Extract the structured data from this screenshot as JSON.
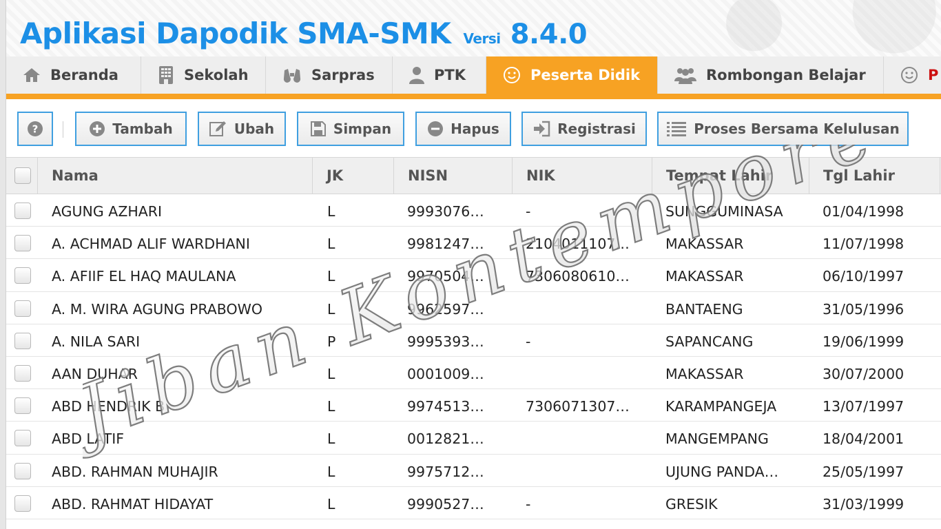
{
  "app": {
    "title": "Aplikasi Dapodik SMA-SMK",
    "version_label": "Versi",
    "version": "8.4.0"
  },
  "tabs": [
    {
      "label": "Beranda",
      "icon": "home-icon"
    },
    {
      "label": "Sekolah",
      "icon": "building-icon"
    },
    {
      "label": "Sarpras",
      "icon": "binoculars-icon"
    },
    {
      "label": "PTK",
      "icon": "user-icon"
    },
    {
      "label": "Peserta Didik",
      "icon": "smile-icon",
      "active": true
    },
    {
      "label": "Rombongan Belajar",
      "icon": "group-icon"
    },
    {
      "label": "P",
      "icon": "smile-icon"
    }
  ],
  "toolbar": {
    "tambah": "Tambah",
    "ubah": "Ubah",
    "simpan": "Simpan",
    "hapus": "Hapus",
    "registrasi": "Registrasi",
    "kelulusan": "Proses Bersama Kelulusan"
  },
  "table": {
    "headers": [
      "Nama",
      "JK",
      "NISN",
      "NIK",
      "Tempat Lahir",
      "Tgl Lahir"
    ],
    "rows": [
      [
        "AGUNG AZHARI",
        "L",
        "9993076…",
        "-",
        "SUNGGUMINASA",
        "01/04/1998"
      ],
      [
        "A. ACHMAD ALIF WARDHANI",
        "L",
        "9981247…",
        "2104011107…",
        "MAKASSAR",
        "11/07/1998"
      ],
      [
        "A. AFIIF EL HAQ MAULANA",
        "L",
        "9970504…",
        "7306080610…",
        "MAKASSAR",
        "06/10/1997"
      ],
      [
        "A. M. WIRA AGUNG PRABOWO",
        "L",
        "9962597…",
        "",
        "BANTAENG",
        "31/05/1996"
      ],
      [
        "A. NILA SARI",
        "P",
        "9995393…",
        "-",
        "SAPANCANG",
        "19/06/1999"
      ],
      [
        "AAN DUHAR",
        "L",
        "0001009…",
        "",
        "MAKASSAR",
        "30/07/2000"
      ],
      [
        "ABD HENDRIK B",
        "L",
        "9974513…",
        "7306071307…",
        "KARAMPANGEJA",
        "13/07/1997"
      ],
      [
        "ABD LATIF",
        "L",
        "0012821…",
        "",
        "MANGEMPANG",
        "18/04/2001"
      ],
      [
        "ABD. RAHMAN MUHAJIR",
        "L",
        "9975712…",
        "",
        "UJUNG PANDA…",
        "25/05/1997"
      ],
      [
        "ABD. RAHMAT HIDAYAT",
        "L",
        "9990527…",
        "-",
        "GRESIK",
        "31/03/1999"
      ]
    ]
  },
  "watermark": "Jiban Kontemporer",
  "colors": {
    "accent": "#f7a223",
    "title": "#1c8fe6",
    "button_border": "#3f9fe0"
  }
}
